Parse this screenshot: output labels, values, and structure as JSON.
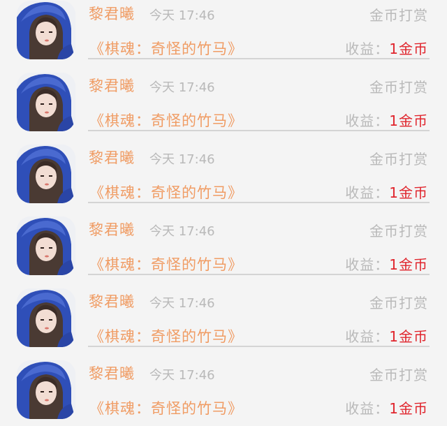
{
  "entries": [
    {
      "name": "黎君曦",
      "time": "今天 17:46",
      "tip": "金币打赏",
      "book": "《棋魂：奇怪的竹马》",
      "earn_label": "收益：",
      "earn_value": "1金币"
    },
    {
      "name": "黎君曦",
      "time": "今天 17:46",
      "tip": "金币打赏",
      "book": "《棋魂：奇怪的竹马》",
      "earn_label": "收益：",
      "earn_value": "1金币"
    },
    {
      "name": "黎君曦",
      "time": "今天 17:46",
      "tip": "金币打赏",
      "book": "《棋魂：奇怪的竹马》",
      "earn_label": "收益：",
      "earn_value": "1金币"
    },
    {
      "name": "黎君曦",
      "time": "今天 17:46",
      "tip": "金币打赏",
      "book": "《棋魂：奇怪的竹马》",
      "earn_label": "收益：",
      "earn_value": "1金币"
    },
    {
      "name": "黎君曦",
      "time": "今天 17:46",
      "tip": "金币打赏",
      "book": "《棋魂：奇怪的竹马》",
      "earn_label": "收益：",
      "earn_value": "1金币"
    },
    {
      "name": "黎君曦",
      "time": "今天 17:46",
      "tip": "金币打赏",
      "book": "《棋魂：奇怪的竹马》",
      "earn_label": "收益：",
      "earn_value": "1金币"
    }
  ],
  "colors": {
    "name": "#f09c64",
    "muted": "#b9b9b9",
    "earn_value": "#e0242c",
    "avatar_hood": "#2f4fb8"
  }
}
